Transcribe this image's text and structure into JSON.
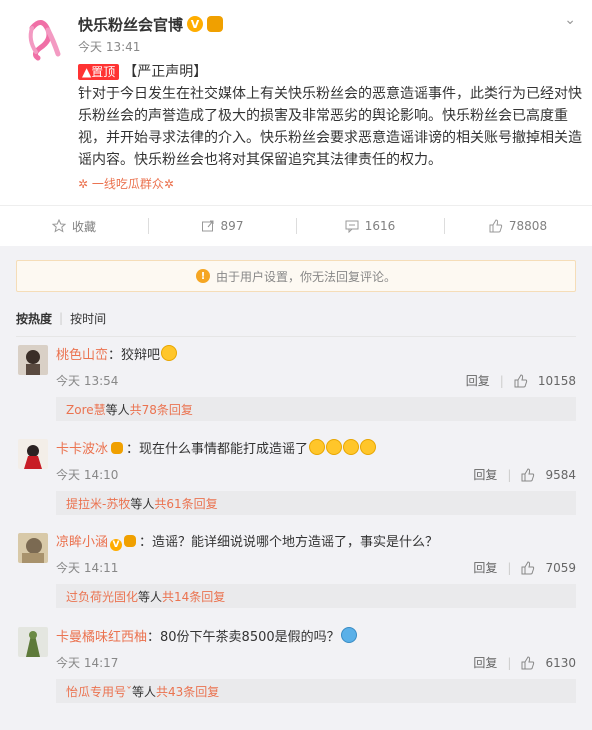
{
  "post": {
    "username": "快乐粉丝会官博",
    "time": "今天 13:41",
    "pin_label": "置顶",
    "tag": "【严正声明】",
    "body": "针对于今日发生在社交媒体上有关快乐粉丝会的恶意造谣事件，此类行为已经对快乐粉丝会的声誉造成了极大的损害及非常恶劣的舆论影响。快乐粉丝会已高度重视，并开始寻求法律的介入。快乐粉丝会要求恶意造谣诽谤的相关账号撤掉相关造谣内容。快乐粉丝会也将对其保留追究其法律责任的权力。",
    "source": "一线吃瓜群众",
    "icons": [
      "pink-ribbon-logo",
      "verified-v-icon",
      "crown-icon",
      "chevron-down-icon"
    ]
  },
  "actions": {
    "favorite": "收藏",
    "repost": "897",
    "comment": "1616",
    "like": "78808"
  },
  "notice": "由于用户设置，你无法回复评论。",
  "sort": {
    "hot": "按热度",
    "time": "按时间"
  },
  "comments": [
    {
      "name": "桃色山峦",
      "text": "：狡辩吧",
      "time": "今天 13:54",
      "reply": "回复",
      "likes": "10158",
      "reply_user": "Zore慧",
      "reply_mid": " 等人 ",
      "reply_count": "共78条回复"
    },
    {
      "name": "卡卡波冰",
      "text": "：现在什么事情都能打成造谣了",
      "time": "今天 14:10",
      "reply": "回复",
      "likes": "9584",
      "reply_user": "提拉米-苏牧",
      "reply_mid": " 等人 ",
      "reply_count": "共61条回复"
    },
    {
      "name": "凉眸小涵",
      "text": "：造谣？能详细说说哪个地方造谣了，事实是什么？",
      "time": "今天 14:11",
      "reply": "回复",
      "likes": "7059",
      "reply_user": "过负荷光固化",
      "reply_mid": " 等人 ",
      "reply_count": "共14条回复"
    },
    {
      "name": "卡曼橘味红西柚",
      "text": "：80份下午茶卖8500是假的吗？",
      "time": "今天 14:17",
      "reply": "回复",
      "likes": "6130",
      "reply_user": "怡瓜专用号ˇ",
      "reply_mid": " 等人 ",
      "reply_count": "共43条回复"
    }
  ]
}
